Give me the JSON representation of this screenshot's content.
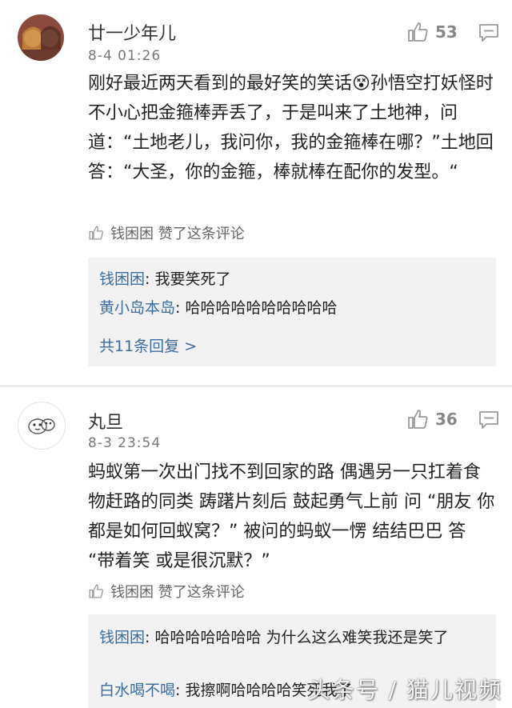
{
  "comments": [
    {
      "username": "廿一少年儿",
      "timestamp": "8-4 01:26",
      "likes": "53",
      "body": "刚好最近两天看到的最好笑的笑话😵孙悟空打妖怪时不小心把金箍棒弄丢了，于是叫来了土地神，问道：“土地老儿，我问你，我的金箍棒在哪？”土地回答：“大圣，你的金箍，棒就棒在配你的发型。“",
      "liked_by": "钱困困 赞了这条评论",
      "replies": [
        {
          "user": "钱困困",
          "text": "我要笑死了"
        },
        {
          "user": "黄小岛本岛",
          "text": "哈哈哈哈哈哈哈哈哈哈"
        }
      ],
      "reply_count": "共11条回复 >"
    },
    {
      "username": "丸旦",
      "timestamp": "8-3 23:54",
      "likes": "36",
      "body": "蚂蚁第一次出门找不到回家的路 偶遇另一只扛着食物赶路的同类 踌躇片刻后 鼓起勇气上前 问 “朋友 你都是如何回蚁窝？” 被问的蚂蚁一愣 结结巴巴 答 “带着笑 或是很沉默？”",
      "liked_by": "钱困困 赞了这条评论",
      "replies": [
        {
          "user": "钱困困",
          "text": "哈哈哈哈哈哈哈 为什么这么难笑我还是笑了"
        },
        {
          "user": "白水喝不喝",
          "text": "我擦啊哈哈哈哈笑死我了"
        }
      ]
    }
  ],
  "watermark": "头条号 / 猫儿视频",
  "icons": {
    "like": "thumbs-up-icon",
    "reply": "comment-bubble-icon"
  },
  "colors": {
    "link": "#3b6da3",
    "reply_bg": "#f2f2f2",
    "muted": "#888888"
  }
}
